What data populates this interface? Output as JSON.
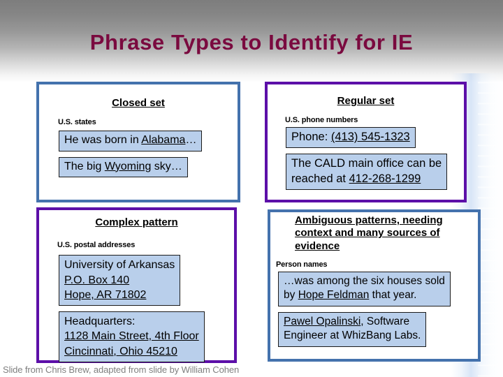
{
  "slide": {
    "title": "Phrase Types to Identify for IE",
    "title_color": "#7a0a3f",
    "footer_credit": "Slide from Chris Brew, adapted from slide by William Cohen",
    "footer_color": "#7f7f7f",
    "background": {
      "top_gradient_from": "#7d7d7d",
      "top_gradient_to": "#ffffff",
      "right_band_color": "#b8d0f0"
    }
  },
  "panels": [
    {
      "id": "closed-set",
      "heading": "Closed set",
      "sublabel": "U.S. states",
      "border_color": "#4472ad",
      "fill_color": "#ffffff",
      "example_fill": "#b9cfeb",
      "examples": [
        {
          "before": "He was born in ",
          "highlight": "Alabama",
          "after": "…"
        },
        {
          "before": "The big ",
          "highlight": "Wyoming",
          "after": " sky…"
        }
      ]
    },
    {
      "id": "regular-set",
      "heading": "Regular set",
      "sublabel": "U.S. phone numbers",
      "border_color": "#5c0fa8",
      "fill_color": "#ffffff",
      "example_fill": "#b9cfeb",
      "examples": [
        {
          "before": "Phone: ",
          "highlight": "(413) 545-1323",
          "after": ""
        },
        {
          "before": "The CALD main office can be\nreached at ",
          "highlight": "412-268-1299",
          "after": ""
        }
      ]
    },
    {
      "id": "complex-pattern",
      "heading": "Complex pattern",
      "sublabel": "U.S. postal addresses",
      "border_color": "#5c0fa8",
      "fill_color": "#ffffff",
      "example_fill": "#b9cfeb",
      "examples": [
        {
          "before": "University of Arkansas\n",
          "highlight": "P.O. Box 140\nHope, AR  71802",
          "after": ""
        },
        {
          "before": "Headquarters:\n",
          "highlight": "1128 Main Street, 4th Floor\nCincinnati, Ohio 45210",
          "after": ""
        }
      ]
    },
    {
      "id": "ambiguous-patterns",
      "heading": "Ambiguous patterns,\nneeding context and\nmany sources of evidence",
      "sublabel": "Person names",
      "border_color": "#4472ad",
      "fill_color": "#ffffff",
      "example_fill": "#b9cfeb",
      "examples": [
        {
          "before": "…was among the six houses sold\nby ",
          "highlight": "Hope Feldman",
          "after": " that year."
        },
        {
          "before": "",
          "highlight": "Pawel Opalinski",
          "after": ", Software\nEngineer at WhizBang Labs."
        }
      ]
    }
  ]
}
